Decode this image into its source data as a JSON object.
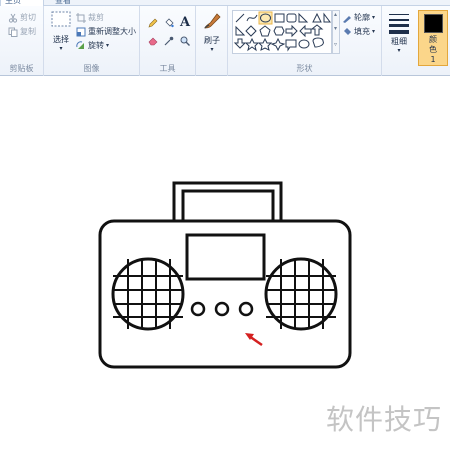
{
  "tabs": {
    "home": "主页",
    "view": "查看"
  },
  "clipboard": {
    "cut": "剪切",
    "copy": "复制",
    "caption": "剪贴板"
  },
  "image": {
    "select": "选择",
    "crop": "裁剪",
    "resize": "重新调整大小",
    "rotate": "旋转",
    "caption": "图像"
  },
  "tools": {
    "caption": "工具",
    "text_glyph": "A"
  },
  "brushes": {
    "label": "刷子"
  },
  "shapes": {
    "outline": "轮廓",
    "fill": "填充",
    "caption": "形状"
  },
  "size": {
    "label": "粗细"
  },
  "color": {
    "label": "颜色 1",
    "value": "#000000"
  },
  "watermark": "软件技巧"
}
